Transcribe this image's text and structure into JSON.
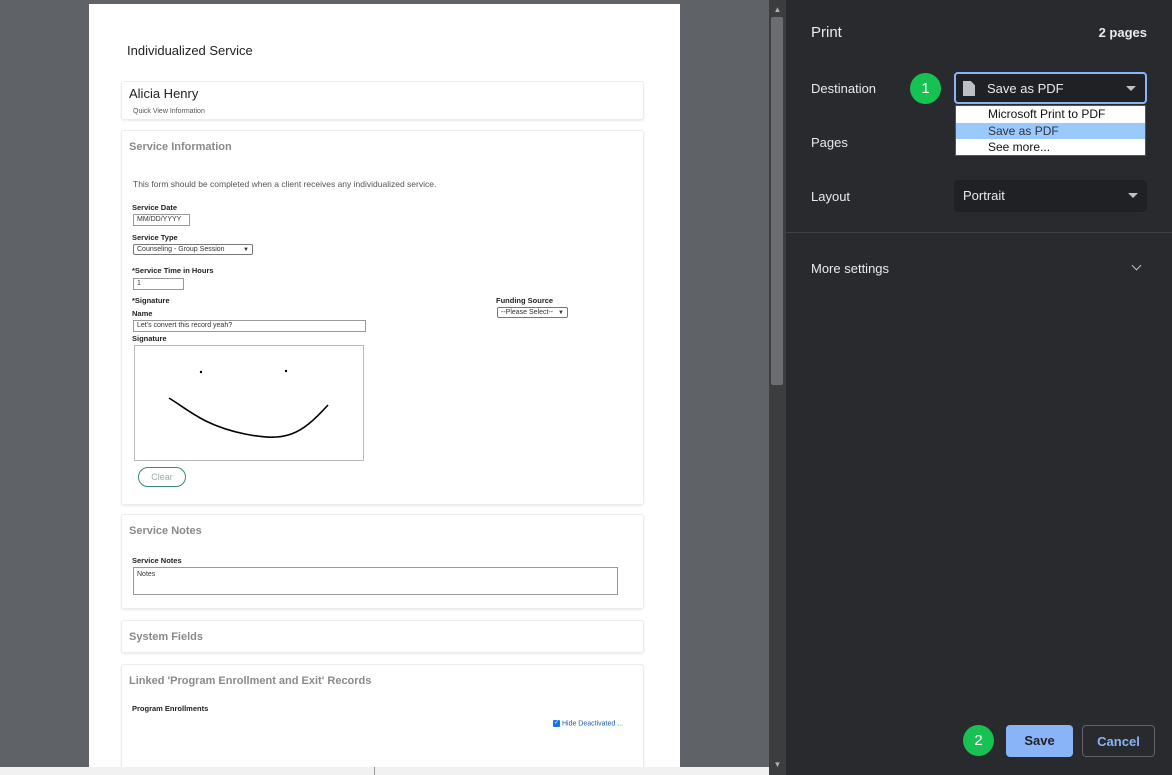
{
  "document": {
    "title": "Individualized Service",
    "client": {
      "name": "Alicia Henry",
      "subtitle": "Quick View Information"
    },
    "service_information": {
      "heading": "Service Information",
      "intro": "This form should be completed when a client receives any individualized service.",
      "service_date_label": "Service Date",
      "service_date_placeholder": "MM/DD/YYYY",
      "service_type_label": "Service Type",
      "service_type_value": "Counseling - Group Session",
      "service_time_label": "*Service Time in Hours",
      "service_time_value": "1",
      "signature_label": "*Signature",
      "name_label": "Name",
      "name_value": "Let's convert this record yeah?",
      "signature_pad_label": "Signature",
      "clear_label": "Clear",
      "funding_source_label": "Funding Source",
      "funding_source_value": "--Please Select--"
    },
    "service_notes": {
      "heading": "Service Notes",
      "label": "Service Notes",
      "value": "Notes"
    },
    "system_fields": {
      "heading": "System Fields"
    },
    "linked_records": {
      "heading": "Linked 'Program Enrollment and Exit' Records",
      "program_enrollments_label": "Program Enrollments",
      "hide_deactivated_label": "Hide Deactivated ..."
    }
  },
  "print_panel": {
    "title": "Print",
    "page_count": "2 pages",
    "destination_label": "Destination",
    "destination_value": "Save as PDF",
    "destination_options": [
      "Microsoft Print to PDF",
      "Save as PDF",
      "See more..."
    ],
    "pages_label": "Pages",
    "layout_label": "Layout",
    "layout_value": "Portrait",
    "more_settings_label": "More settings",
    "save_label": "Save",
    "cancel_label": "Cancel",
    "step_badges": [
      "1",
      "2"
    ]
  }
}
